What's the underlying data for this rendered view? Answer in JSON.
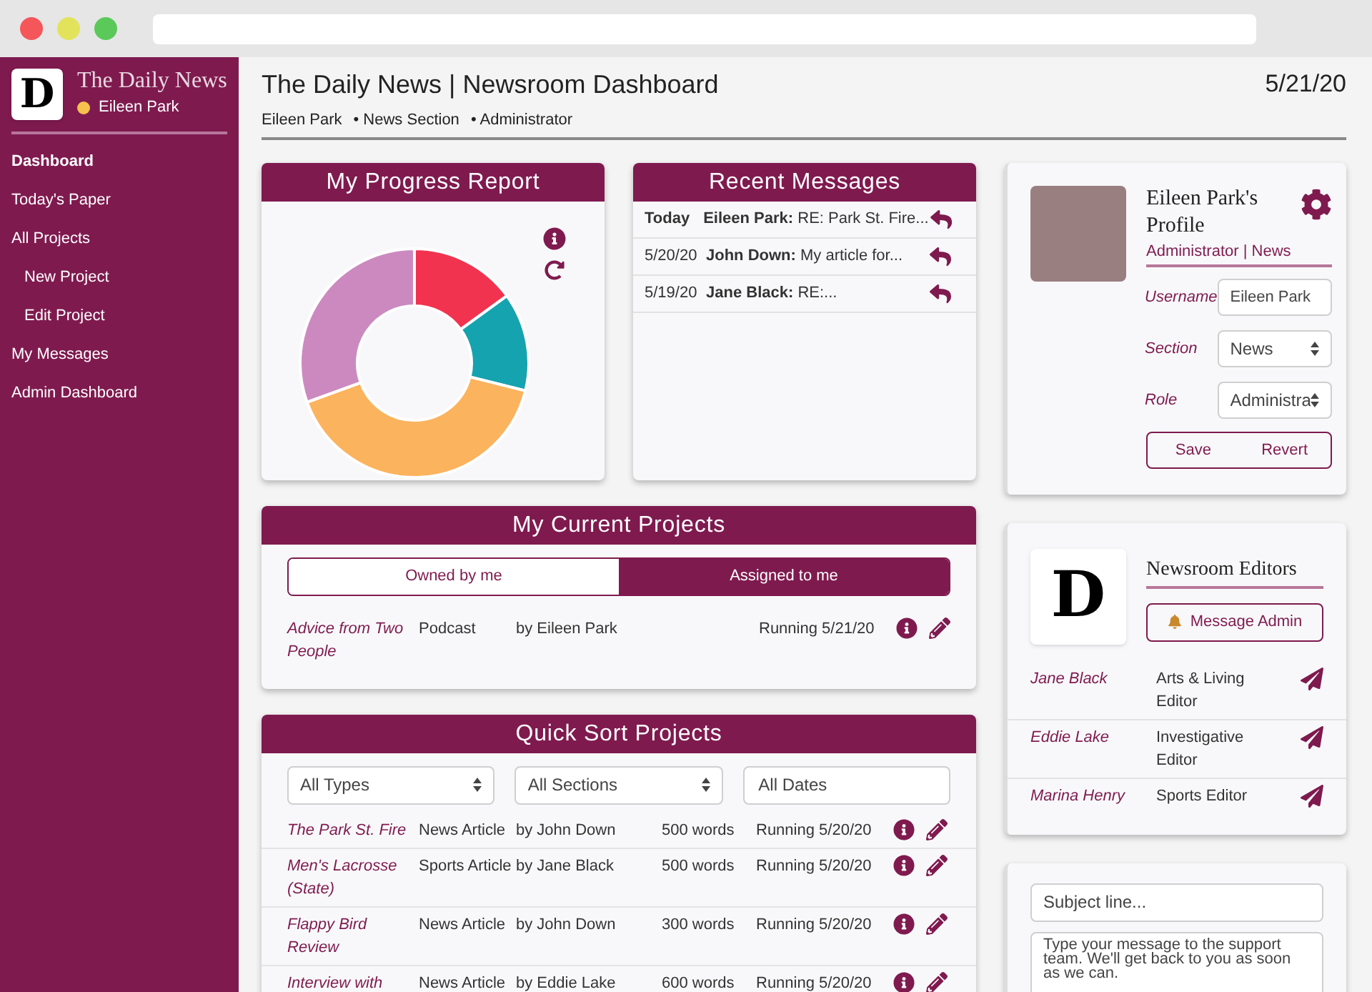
{
  "sidebar": {
    "logo_letter": "D",
    "brand": "The Daily News",
    "user": "Eileen Park",
    "items": [
      {
        "label": "Dashboard",
        "selected": true
      },
      {
        "label": "Today's Paper",
        "selected": false
      },
      {
        "label": "All Projects",
        "selected": false,
        "children": [
          {
            "label": "New Project",
            "selected": false
          },
          {
            "label": "Edit Project",
            "selected": false
          }
        ]
      },
      {
        "label": "My Messages",
        "selected": false
      },
      {
        "label": "Admin Dashboard",
        "selected": false
      }
    ]
  },
  "header": {
    "title": "The Daily News | Newsroom Dashboard",
    "date": "5/21/20",
    "meta": [
      "Eileen Park",
      "• News Section",
      "• Administrator"
    ]
  },
  "progress_report": {
    "title": "My Progress Report"
  },
  "recent_messages": {
    "title": "Recent Messages",
    "rows": [
      {
        "date": "Today",
        "sender": "Eileen Park:",
        "preview": "RE: Park St. Fire...",
        "bold_date": true
      },
      {
        "date": "5/20/20",
        "sender": "John Down:",
        "preview": "My article for...",
        "bold_date": false
      },
      {
        "date": "5/19/20",
        "sender": "Jane Black:",
        "preview": "RE:...",
        "bold_date": false
      }
    ]
  },
  "current_projects": {
    "title": "My Current Projects",
    "tabs": [
      {
        "label": "Owned by me",
        "selected": false
      },
      {
        "label": "Assigned to me",
        "selected": true
      }
    ],
    "rows": [
      {
        "name": "Advice from Two People",
        "type": "Podcast",
        "author": "by Eileen Park",
        "status": "Running 5/21/20"
      }
    ]
  },
  "quick_sort": {
    "title": "Quick Sort Projects",
    "filters": [
      {
        "kind": "select",
        "value": "All Types"
      },
      {
        "kind": "select",
        "value": "All Sections"
      },
      {
        "kind": "input",
        "value": "All Dates"
      }
    ],
    "rows": [
      {
        "name": "The Park St. Fire",
        "type": "News Article",
        "author": "by John Down",
        "words": "500 words",
        "status": "Running 5/20/20"
      },
      {
        "name": "Men's Lacrosse (State)",
        "type": "Sports Article",
        "author": "by Jane Black",
        "words": "500 words",
        "status": "Running 5/20/20"
      },
      {
        "name": "Flappy Bird Review",
        "type": "News Article",
        "author": "by John Down",
        "words": "300 words",
        "status": "Running 5/20/20"
      },
      {
        "name": "Interview with",
        "type": "News Article",
        "author": "by Eddie Lake",
        "words": "600 words",
        "status": "Running 5/20/20"
      }
    ]
  },
  "profile": {
    "title": "Eileen Park's Profile",
    "subtitle": "Administrator | News",
    "fields": [
      {
        "label": "Username",
        "kind": "input",
        "value": "Eileen Park"
      },
      {
        "label": "Section",
        "kind": "select",
        "value": "News"
      },
      {
        "label": "Role",
        "kind": "select",
        "value": "Administra"
      }
    ],
    "buttons": [
      "Save",
      "Revert"
    ]
  },
  "editors": {
    "logo_letter": "D",
    "title": "Newsroom Editors",
    "button": "Message Admin",
    "rows": [
      {
        "name": "Jane Black",
        "role": "Arts & Living Editor"
      },
      {
        "name": "Eddie Lake",
        "role": "Investigative Editor"
      },
      {
        "name": "Marina Henry",
        "role": "Sports Editor"
      }
    ]
  },
  "support": {
    "subject_placeholder": "Subject line...",
    "message_placeholder": "Type your message to the support team. We'll get back to you as soon as we can."
  }
}
